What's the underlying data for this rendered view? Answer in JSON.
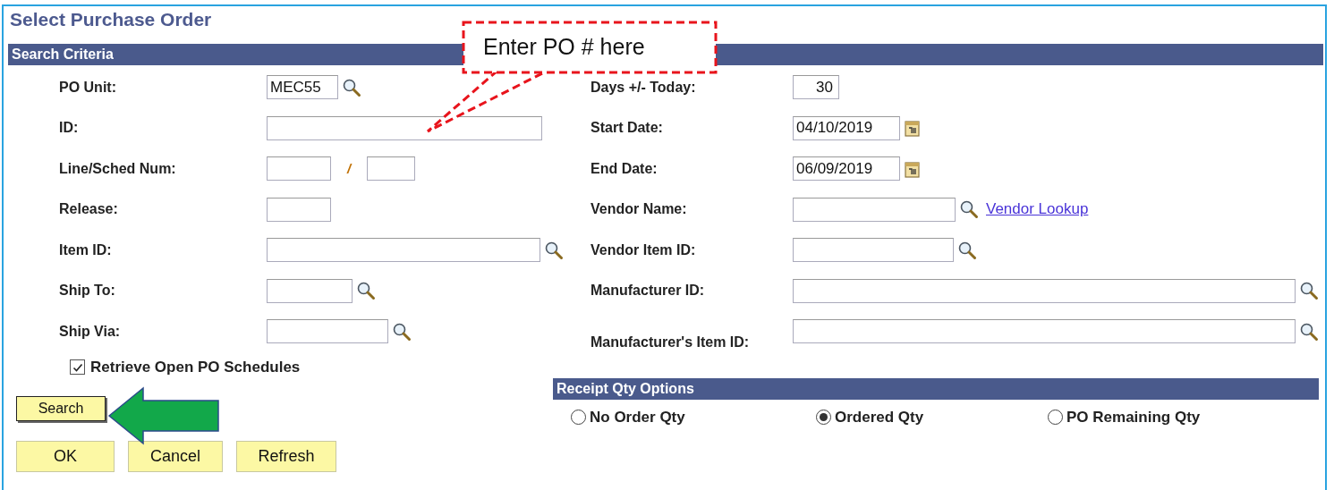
{
  "page": {
    "title": "Select Purchase Order"
  },
  "search_criteria": {
    "title": "Search Criteria",
    "left_fields": [
      {
        "label": "PO Unit:",
        "kind": "lookup",
        "value": "MEC55"
      },
      {
        "label": "ID:",
        "kind": "input"
      },
      {
        "label": "Line/Sched Num:",
        "kind": "pair",
        "separator": "/"
      },
      {
        "label": "Release:",
        "kind": "input"
      },
      {
        "label": "Item ID:",
        "kind": "lookup"
      },
      {
        "label": "Ship To:",
        "kind": "lookup"
      },
      {
        "label": "Ship Via:",
        "kind": "lookup"
      }
    ],
    "right_fields": [
      {
        "label": "Days +/- Today:",
        "kind": "number",
        "value": "30"
      },
      {
        "label": "Start Date:",
        "kind": "date",
        "value": "04/10/2019"
      },
      {
        "label": "End Date:",
        "kind": "date",
        "value": "06/09/2019"
      },
      {
        "label": "Vendor Name:",
        "kind": "lookup",
        "link": "Vendor Lookup"
      },
      {
        "label": "Vendor Item ID:",
        "kind": "lookup"
      },
      {
        "label": "Manufacturer ID:",
        "kind": "lookup"
      },
      {
        "label": "Manufacturer's Item ID:",
        "kind": "lookup"
      }
    ],
    "retrieve_open_schedules": {
      "label": "Retrieve Open PO Schedules",
      "checked": true
    },
    "search_button": "Search"
  },
  "receipt_qty_options": {
    "title": "Receipt Qty Options",
    "options": [
      {
        "label": "No Order Qty",
        "selected": false
      },
      {
        "label": "Ordered Qty",
        "selected": true
      },
      {
        "label": "PO Remaining Qty",
        "selected": false
      }
    ]
  },
  "buttons": [
    "OK",
    "Cancel",
    "Refresh"
  ],
  "callout": {
    "text": "Enter PO # here"
  }
}
